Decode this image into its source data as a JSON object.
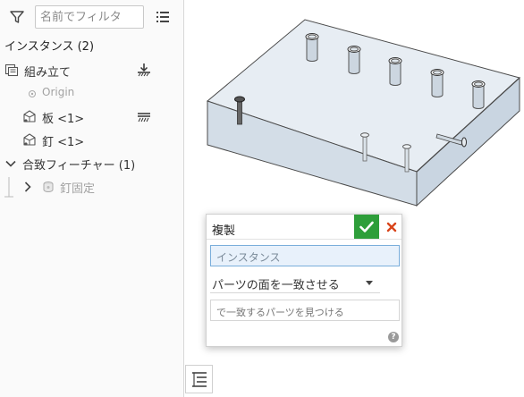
{
  "filter": {
    "placeholder": "名前でフィルタ"
  },
  "instances": {
    "header": "インスタンス (2)"
  },
  "tree": {
    "assembly": {
      "label": "組み立て"
    },
    "origin": {
      "label": "Origin"
    },
    "plate": {
      "label": "板 <1>"
    },
    "nail": {
      "label": "釘 <1>"
    },
    "mate_features": {
      "label": "合致フィーチャー (1)"
    },
    "nail_fix": {
      "label": "釘固定"
    }
  },
  "dialog": {
    "title": "複製",
    "instance_placeholder": "インスタンス",
    "mate_option": "パーツの面を一致させる",
    "find_parts_placeholder": "で一致するパーツを見つける",
    "help": "?"
  },
  "colors": {
    "accept": "#2e9e3a",
    "cancel": "#d9441a",
    "selection": "#e8f1fb",
    "part_fill": "#dde6ee"
  },
  "icons": [
    "filter-icon",
    "list-view-icon",
    "assembly-icon",
    "fix-ground-icon",
    "origin-icon",
    "part-icon",
    "chevron-down-icon",
    "chevron-right-icon",
    "mate-fastened-icon",
    "check-icon",
    "close-icon",
    "help-icon",
    "tree-toggle-icon"
  ]
}
